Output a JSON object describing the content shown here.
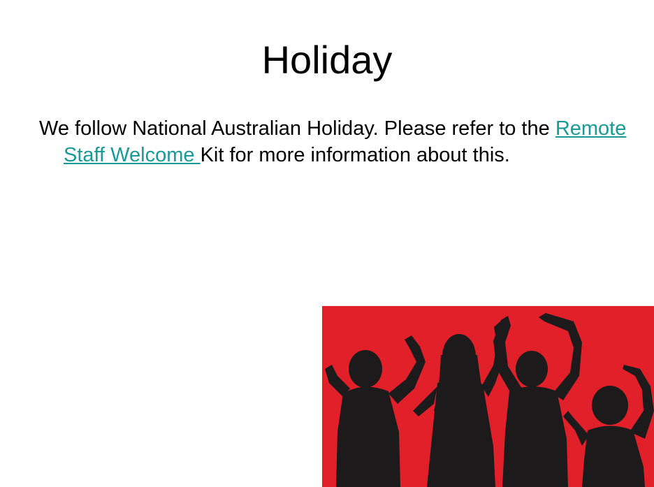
{
  "slide": {
    "title": "Holiday",
    "body": {
      "text_before": "We follow National Australian Holiday. Please refer to the ",
      "link_label": "Remote Staff Welcome ",
      "text_after": "Kit for more information about this."
    }
  },
  "image": {
    "icon": "dancing-people-silhouette",
    "background_color": "#e1202a",
    "silhouette_color": "#1d1a1c"
  },
  "colors": {
    "link": "#1a9a96",
    "text": "#000000"
  }
}
